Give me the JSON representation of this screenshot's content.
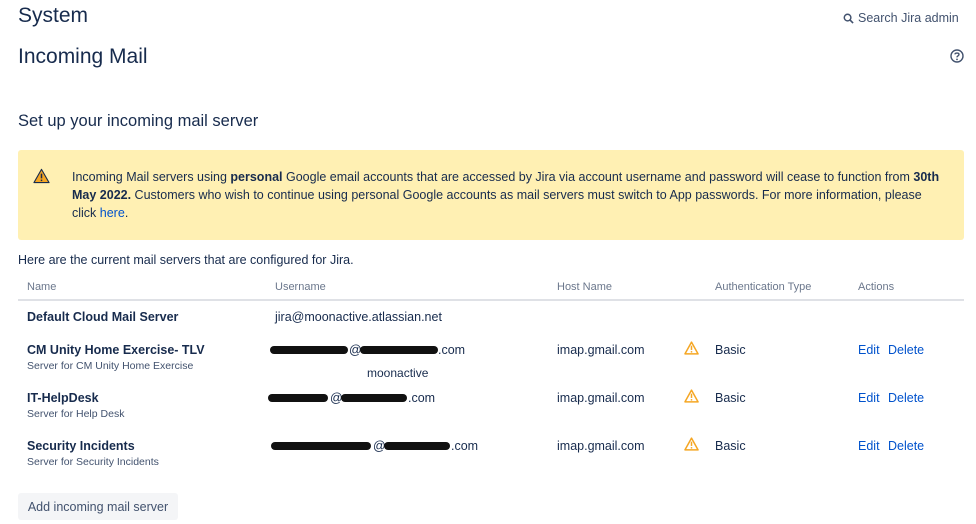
{
  "header": {
    "system_title": "System",
    "search_label": "Search Jira admin",
    "page_title": "Incoming Mail"
  },
  "section_title": "Set up your incoming mail server",
  "warning": {
    "text_1": "Incoming Mail servers using ",
    "bold_1": "personal",
    "text_2": " Google email accounts that are accessed by Jira via account username and password will cease to function from ",
    "bold_2": "30th May 2022.",
    "text_3": " Customers who wish to continue using personal Google accounts as mail servers must switch to App passwords. For more information, please click ",
    "link": "here",
    "text_4": "."
  },
  "intro": "Here are the current mail servers that are configured for Jira.",
  "table": {
    "headers": {
      "name": "Name",
      "username": "Username",
      "host": "Host Name",
      "auth": "Authentication Type",
      "actions": "Actions"
    },
    "rows": [
      {
        "name": "Default Cloud Mail Server",
        "desc": "",
        "username": "jira@moonactive.atlassian.net",
        "host": "",
        "auth": "",
        "edit": "",
        "delete": ""
      },
      {
        "name": "CM Unity Home Exercise- TLV",
        "desc": "Server for CM Unity Home Exercise",
        "username_prefix": "@",
        "username_suffix": ".com",
        "username_line2": "moonactive",
        "host": "imap.gmail.com",
        "auth": "Basic",
        "edit": "Edit",
        "delete": "Delete"
      },
      {
        "name": "IT-HelpDesk",
        "desc": "Server for Help Desk",
        "username_prefix": "@",
        "username_suffix": ".com",
        "host": "imap.gmail.com",
        "auth": "Basic",
        "edit": "Edit",
        "delete": "Delete"
      },
      {
        "name": "Security Incidents",
        "desc": "Server for Security Incidents",
        "username_prefix": "@",
        "username_suffix": ".com",
        "host": "imap.gmail.com",
        "auth": "Basic",
        "edit": "Edit",
        "delete": "Delete"
      }
    ]
  },
  "add_button": "Add incoming mail server",
  "colors": {
    "link": "#0052cc",
    "warning_bg": "#fff0b3",
    "warning_icon": "#f5a623",
    "text": "#172b4d"
  },
  "icons": {
    "search": "search-icon",
    "help": "help-icon",
    "warning": "warning-icon"
  }
}
